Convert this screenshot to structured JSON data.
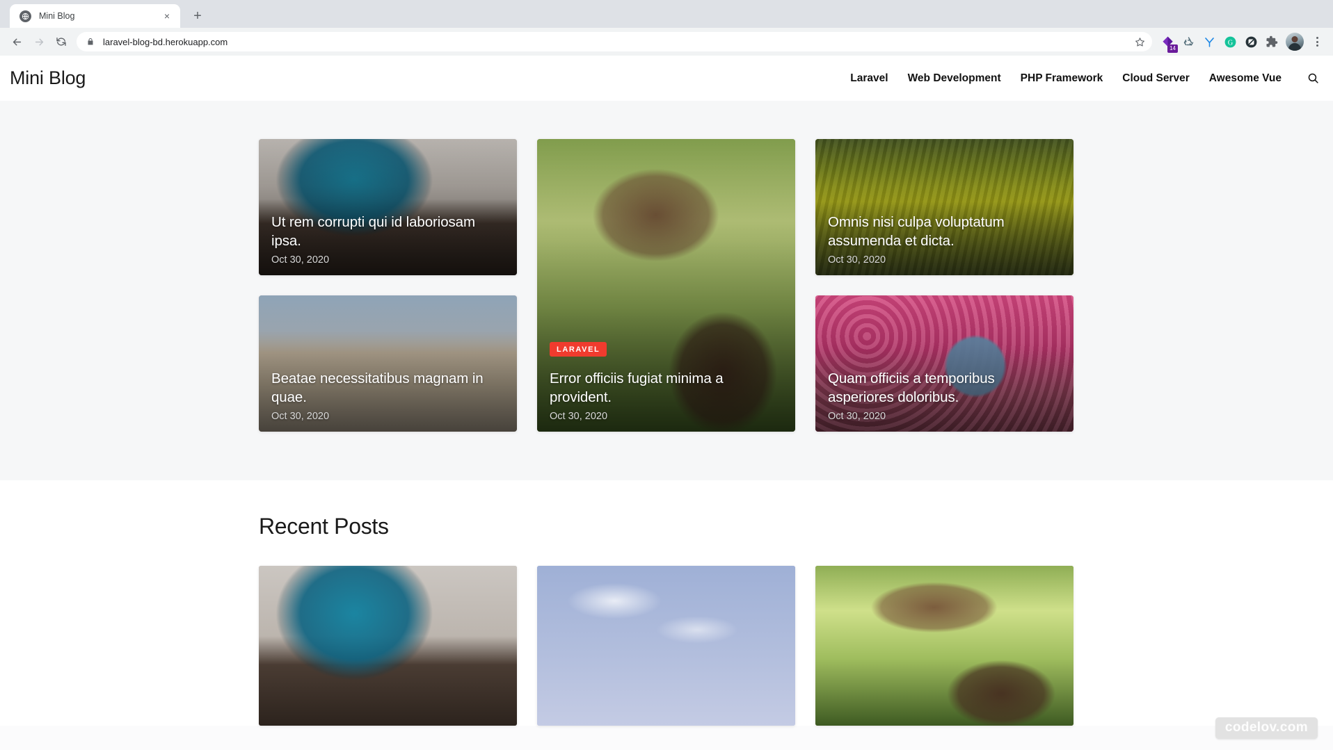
{
  "browser": {
    "tab": {
      "title": "Mini Blog",
      "favicon": "globe-icon",
      "close": "×"
    },
    "new_tab_label": "+",
    "url": "laravel-blog-bd.herokuapp.com",
    "back_label": "←",
    "forward_label": "→",
    "reload_label": "↻",
    "extensions": [
      {
        "name": "purple-diamond-extension-icon",
        "badge": "14",
        "color": "#6a1b9a"
      },
      {
        "name": "recycle-extension-icon",
        "badge": "",
        "color": "#546e7a"
      },
      {
        "name": "y-extension-icon",
        "badge": "",
        "color": "#2196f3"
      },
      {
        "name": "grammarly-extension-icon",
        "badge": "",
        "color": "#15c39a"
      },
      {
        "name": "adblock-extension-icon",
        "badge": "",
        "color": "#263238"
      },
      {
        "name": "puzzle-extensions-icon",
        "badge": "",
        "color": "#5f6368"
      }
    ],
    "profile": "avatar",
    "menu": "three-dot-menu-icon"
  },
  "site": {
    "brand": "Mini Blog",
    "nav": [
      {
        "label": "Laravel"
      },
      {
        "label": "Web Development"
      },
      {
        "label": "PHP Framework"
      },
      {
        "label": "Cloud Server"
      },
      {
        "label": "Awesome Vue"
      }
    ],
    "search_icon": "search-icon"
  },
  "hero": {
    "cards": [
      {
        "title": "Ut rem corrupti qui id laboriosam ipsa.",
        "date": "Oct 30, 2020",
        "badge": "",
        "image": "man-drinking-coffee-at-desk"
      },
      {
        "title": "Beatae necessitatibus magnam in quae.",
        "date": "Oct 30, 2020",
        "badge": "",
        "image": "mosque-courtyard"
      },
      {
        "title": "Error officiis fugiat minima a provident.",
        "date": "Oct 30, 2020",
        "badge": "LARAVEL",
        "image": "toddler-laughing-outdoors"
      },
      {
        "title": "Omnis nisi culpa voluptatum assumenda et dicta.",
        "date": "Oct 30, 2020",
        "badge": "",
        "image": "yellow-rapeseed-field"
      },
      {
        "title": "Quam officiis a temporibus asperiores doloribus.",
        "date": "Oct 30, 2020",
        "badge": "",
        "image": "woman-in-pink-flower-field"
      }
    ],
    "badge_color": "#f03b2e"
  },
  "recent": {
    "title": "Recent Posts",
    "cards": [
      {
        "image": "man-drinking-coffee-at-desk"
      },
      {
        "image": "blue-sky-with-minaret"
      },
      {
        "image": "toddler-laughing-outdoors"
      }
    ]
  },
  "watermark": {
    "text": "codelov.com"
  }
}
